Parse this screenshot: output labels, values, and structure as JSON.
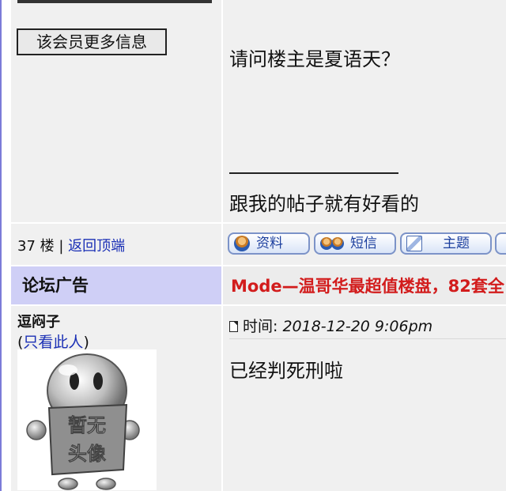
{
  "post": {
    "more_info_button": "该会员更多信息",
    "body": "请问楼主是夏语天？",
    "signature": "跟我的帖子就有好看的"
  },
  "floor": {
    "number_text": "37 楼 | ",
    "back_to_top": "返回顶端",
    "buttons": {
      "profile": "资料",
      "message": "短信",
      "topics": "主题"
    }
  },
  "ad": {
    "label": "论坛广告",
    "text": "Mode—温哥华最超值楼盘，82套全"
  },
  "reply": {
    "username": "逗闷子",
    "only_this_prefix": "(",
    "only_this_link": "只看此人",
    "only_this_suffix": ")",
    "avatar_text": "暂无头像",
    "time_label": "时间:",
    "time_value": "2018-12-20 9:06pm",
    "body": "已经判死刑啦"
  },
  "colors": {
    "cell_bg": "#f0f0f0",
    "ad_label_bg": "#cfcff6",
    "ad_text": "#d21c1c",
    "link": "#1a2fb5",
    "left_rule": "#7b7bd8"
  },
  "icons": [
    "profile-person-icon",
    "message-persons-icon",
    "topics-doc-icon",
    "document-icon"
  ]
}
